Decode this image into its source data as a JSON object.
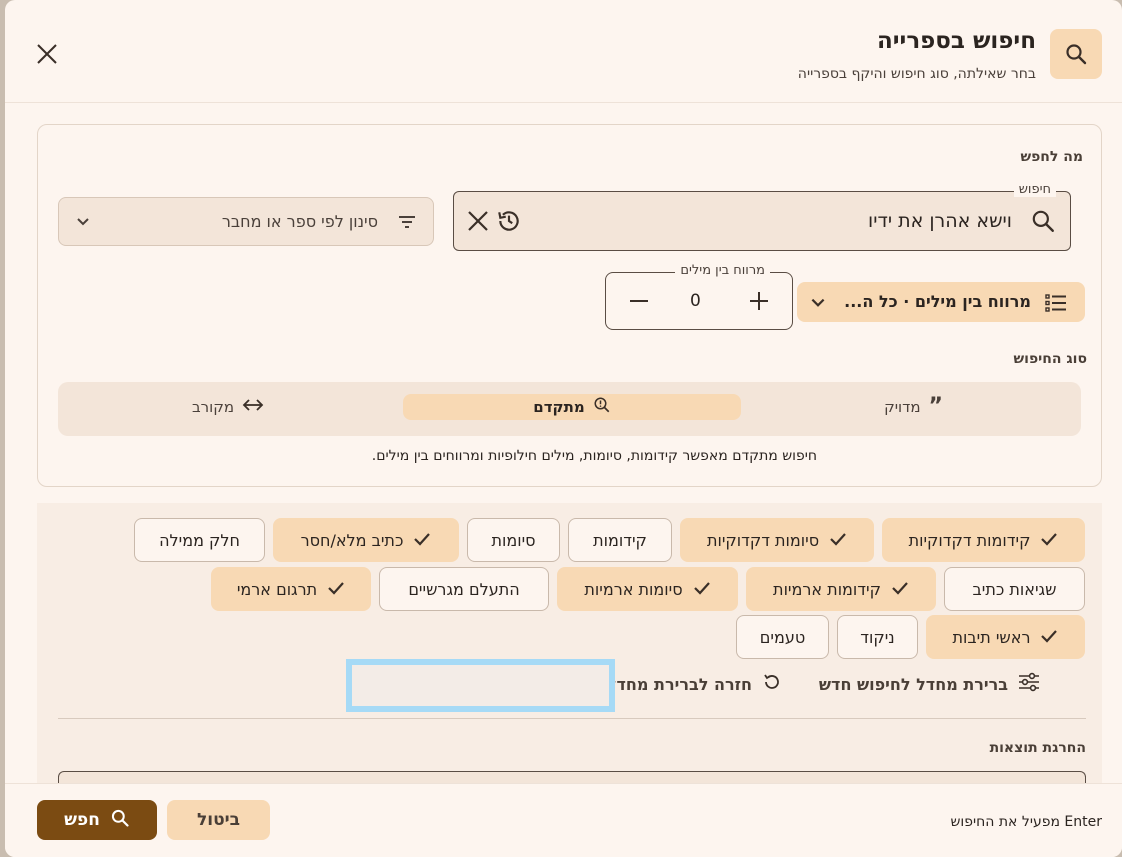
{
  "header": {
    "title": "חיפוש בספרייה",
    "subtitle": "בחר שאילתה, סוג חיפוש והיקף בספרייה"
  },
  "query": {
    "section_label": "מה לחפש",
    "field_label": "חיפוש",
    "value": "וישא אהרן את ידיו",
    "filter_placeholder": "סינון לפי ספר או מחבר",
    "spacing_select_label": "מרווח בין מילים · כל ה...",
    "stepper_label": "מרווח בין מילים",
    "stepper_value": "0"
  },
  "search_type": {
    "section_label": "סוג החיפוש",
    "options": [
      "מדויק",
      "מתקדם",
      "מקורב"
    ],
    "selected": "מתקדם",
    "hint": "חיפוש מתקדם מאפשר קידומות, סיומות, מילים חילופיות ומרווחים בין מילים."
  },
  "options": {
    "chips": [
      {
        "label": "קידומות דקדוקיות",
        "checked": true
      },
      {
        "label": "סיומות דקדוקיות",
        "checked": true
      },
      {
        "label": "קידומות",
        "checked": false
      },
      {
        "label": "סיומות",
        "checked": false
      },
      {
        "label": "כתיב מלא/חסר",
        "checked": true
      },
      {
        "label": "חלק ממילה",
        "checked": false
      },
      {
        "label": "שגיאות כתיב",
        "checked": false
      },
      {
        "label": "קידומות ארמיות",
        "checked": true
      },
      {
        "label": "סיומות ארמיות",
        "checked": true
      },
      {
        "label": "התעלם מגרשיים",
        "checked": false
      },
      {
        "label": "תרגום ארמי",
        "checked": true
      },
      {
        "label": "ראשי תיבות",
        "checked": true
      },
      {
        "label": "ניקוד",
        "checked": false
      },
      {
        "label": "טעמים",
        "checked": false
      }
    ],
    "reset_defaults_label": "ברירת מחדל לחיפוש חדש",
    "back_to_default_label": "חזרה לברירת מחדל",
    "exclusion_label": "החרגת תוצאות"
  },
  "footer": {
    "enter_hint": "Enter מפעיל את החיפוש",
    "cancel_label": "ביטול",
    "search_label": "חפש"
  },
  "colors": {
    "accent": "#f8d9b4",
    "primary_button": "#7b4b12",
    "background": "#fdf5ef"
  }
}
